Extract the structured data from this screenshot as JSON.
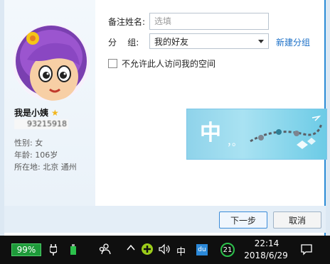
{
  "profile": {
    "nickname": "我是小姨",
    "qq_number": "93215918",
    "gender_label": "性别:",
    "gender_value": "女",
    "age_label": "年龄:",
    "age_value": "106岁",
    "location_label": "所在地:",
    "location_value": "北京  通州"
  },
  "form": {
    "remark_label": "备注姓名:",
    "remark_placeholder": "选填",
    "group_label": "分    组:",
    "group_value": "我的好友",
    "new_group_link": "新建分组",
    "privacy_checkbox_label": "不允许此人访问我的空间"
  },
  "ad": {
    "char": "中",
    "dots": "，。"
  },
  "buttons": {
    "next": "下一步",
    "cancel": "取消"
  },
  "taskbar": {
    "battery": "99%",
    "ime": "中",
    "du": "du",
    "badge": "21",
    "time": "22:14",
    "date": "2018/6/29"
  },
  "colors": {
    "accent": "#2a8bd6",
    "link": "#1a6fc7",
    "battery": "#1e9a3a"
  }
}
